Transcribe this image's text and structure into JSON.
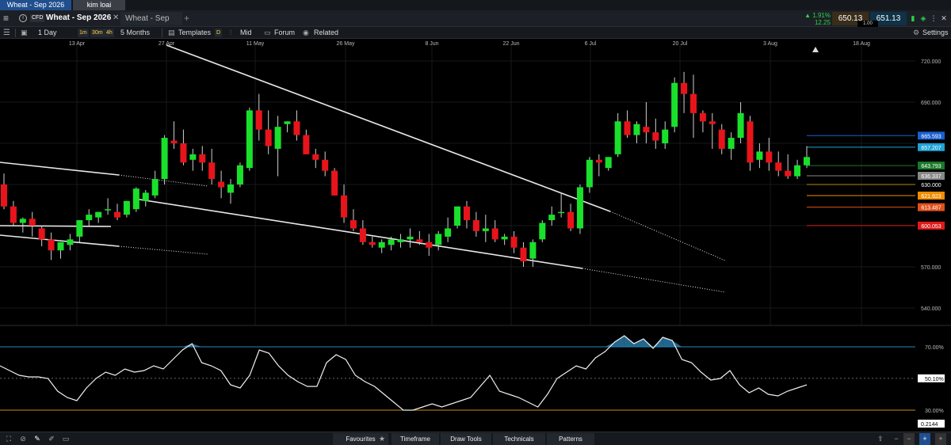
{
  "window_tabs": [
    "Wheat - Sep 2026",
    "kim loai"
  ],
  "instrument": {
    "badge": "CFD",
    "name": "Wheat - Sep 2026",
    "second_tab": "Wheat - Sep 2026",
    "change_pct": "▲ 1.91%",
    "change_abs": "12.25",
    "sell": "650.13",
    "spread": "1.00",
    "buy": "651.13"
  },
  "toolbar": {
    "interval": "1 Day",
    "timeframes": [
      "1m",
      "30m",
      "4h"
    ],
    "range": "5 Months",
    "templates": "Templates",
    "d_badge": "D",
    "price_type": "Mid",
    "forum": "Forum",
    "related": "Related",
    "settings": "Settings"
  },
  "chart_data": {
    "type": "candlestick",
    "x_labels": [
      "13 Apr",
      "27 Apr",
      "11 May",
      "26 May",
      "8 Jun",
      "22 Jun",
      "6 Jul",
      "20 Jul",
      "3 Aug",
      "18 Aug"
    ],
    "y_ticks": [
      "720.000",
      "690.000",
      "570.000",
      "540.000"
    ],
    "price_markers": [
      {
        "label": "665.593",
        "color": "#1a5fd0"
      },
      {
        "label": "657.207",
        "color": "#1ea3d6"
      },
      {
        "label": "643.793",
        "color": "#1a7a2a"
      },
      {
        "label": "636.337",
        "color": "#888888"
      },
      {
        "label": "630.000",
        "color": "#000000"
      },
      {
        "label": "621.923",
        "color": "#f08c00"
      },
      {
        "label": "613.487",
        "color": "#e0501a"
      },
      {
        "label": "600.053",
        "color": "#e01a1a"
      }
    ],
    "ohlc": [
      [
        630,
        638,
        612,
        614
      ],
      [
        614,
        618,
        600,
        602
      ],
      [
        602,
        606,
        595,
        605
      ],
      [
        605,
        610,
        592,
        600
      ],
      [
        598,
        600,
        585,
        590
      ],
      [
        590,
        595,
        575,
        582
      ],
      [
        582,
        588,
        576,
        588
      ],
      [
        586,
        594,
        582,
        590
      ],
      [
        592,
        604,
        588,
        604
      ],
      [
        604,
        612,
        600,
        608
      ],
      [
        606,
        610,
        602,
        610
      ],
      [
        612,
        620,
        608,
        612
      ],
      [
        610,
        616,
        604,
        606
      ],
      [
        608,
        618,
        606,
        618
      ],
      [
        612,
        628,
        610,
        627
      ],
      [
        618,
        626,
        614,
        624
      ],
      [
        622,
        640,
        620,
        634
      ],
      [
        634,
        666,
        630,
        664
      ],
      [
        662,
        676,
        656,
        660
      ],
      [
        660,
        670,
        644,
        646
      ],
      [
        648,
        656,
        640,
        652
      ],
      [
        652,
        658,
        640,
        646
      ],
      [
        646,
        656,
        630,
        634
      ],
      [
        632,
        640,
        620,
        628
      ],
      [
        624,
        634,
        616,
        630
      ],
      [
        630,
        646,
        628,
        644
      ],
      [
        642,
        686,
        640,
        684
      ],
      [
        684,
        696,
        662,
        670
      ],
      [
        670,
        684,
        652,
        658
      ],
      [
        656,
        680,
        636,
        672
      ],
      [
        674,
        676,
        668,
        676
      ],
      [
        676,
        684,
        662,
        666
      ],
      [
        666,
        670,
        652,
        652
      ],
      [
        652,
        656,
        642,
        648
      ],
      [
        648,
        654,
        636,
        640
      ],
      [
        640,
        642,
        622,
        622
      ],
      [
        622,
        630,
        602,
        606
      ],
      [
        604,
        612,
        596,
        598
      ],
      [
        598,
        604,
        586,
        588
      ],
      [
        588,
        592,
        584,
        586
      ],
      [
        584,
        590,
        580,
        588
      ],
      [
        586,
        592,
        582,
        590
      ],
      [
        588,
        594,
        584,
        590
      ],
      [
        590,
        598,
        584,
        592
      ],
      [
        590,
        596,
        586,
        588
      ],
      [
        588,
        594,
        578,
        584
      ],
      [
        586,
        596,
        582,
        594
      ],
      [
        592,
        606,
        588,
        598
      ],
      [
        600,
        614,
        598,
        614
      ],
      [
        614,
        618,
        598,
        604
      ],
      [
        604,
        610,
        592,
        596
      ],
      [
        596,
        608,
        588,
        598
      ],
      [
        598,
        604,
        588,
        590
      ],
      [
        590,
        594,
        586,
        592
      ],
      [
        592,
        596,
        580,
        584
      ],
      [
        584,
        588,
        570,
        574
      ],
      [
        576,
        590,
        570,
        588
      ],
      [
        590,
        604,
        588,
        602
      ],
      [
        604,
        614,
        600,
        608
      ],
      [
        610,
        624,
        606,
        610
      ],
      [
        610,
        616,
        596,
        598
      ],
      [
        598,
        630,
        594,
        628
      ],
      [
        628,
        650,
        624,
        648
      ],
      [
        648,
        652,
        636,
        646
      ],
      [
        642,
        650,
        640,
        650
      ],
      [
        652,
        682,
        650,
        676
      ],
      [
        676,
        684,
        664,
        666
      ],
      [
        666,
        676,
        660,
        674
      ],
      [
        672,
        690,
        660,
        668
      ],
      [
        668,
        678,
        656,
        662
      ],
      [
        660,
        676,
        656,
        670
      ],
      [
        672,
        708,
        668,
        704
      ],
      [
        704,
        712,
        682,
        696
      ],
      [
        696,
        710,
        664,
        682
      ],
      [
        682,
        684,
        668,
        676
      ],
      [
        676,
        682,
        656,
        674
      ],
      [
        670,
        674,
        652,
        656
      ],
      [
        656,
        668,
        648,
        664
      ],
      [
        664,
        690,
        660,
        682
      ],
      [
        676,
        680,
        640,
        646
      ],
      [
        648,
        660,
        642,
        654
      ],
      [
        654,
        664,
        640,
        646
      ],
      [
        646,
        654,
        636,
        640
      ],
      [
        640,
        652,
        634,
        636
      ],
      [
        636,
        648,
        634,
        644
      ],
      [
        644,
        658,
        642,
        650
      ]
    ],
    "rsi_ticks": [
      "70.00%",
      "50.10%",
      "30.00%"
    ],
    "rsi_value": "0.2144",
    "rsi": [
      58,
      55,
      52,
      51,
      51,
      50,
      42,
      38,
      36,
      44,
      50,
      54,
      52,
      56,
      54,
      55,
      58,
      56,
      62,
      68,
      72,
      60,
      58,
      55,
      46,
      44,
      52,
      68,
      66,
      58,
      52,
      48,
      45,
      45,
      60,
      65,
      62,
      52,
      48,
      45,
      40,
      35,
      30,
      30,
      32,
      34,
      32,
      34,
      36,
      38,
      45,
      52,
      42,
      40,
      38,
      35,
      32,
      40,
      50,
      54,
      58,
      56,
      63,
      67,
      73,
      77,
      72,
      75,
      69,
      76,
      74,
      62,
      60,
      54,
      49,
      50,
      55,
      46,
      41,
      44,
      40,
      39,
      42,
      44,
      46
    ]
  },
  "bottom": {
    "favourites": "Favourites",
    "timeframe": "Timeframe",
    "draw_tools": "Draw Tools",
    "technicals": "Technicals",
    "patterns": "Patterns"
  }
}
